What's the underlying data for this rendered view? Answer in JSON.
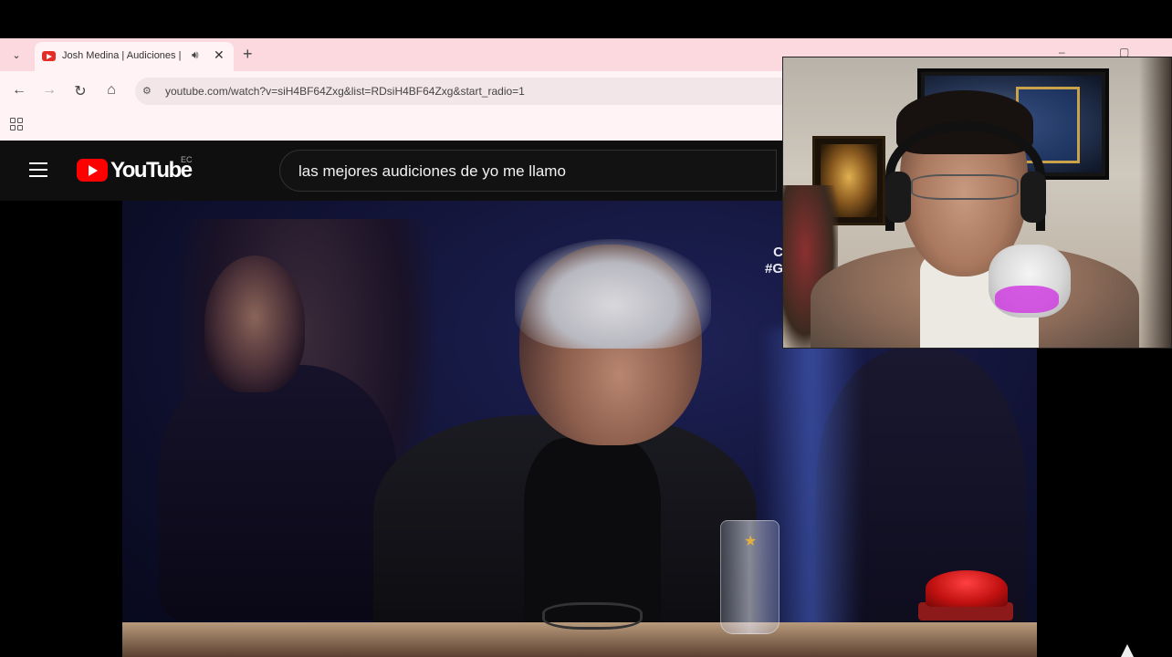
{
  "browser": {
    "tab": {
      "title": "Josh Medina | Audiciones |",
      "audio_icon": "speaker-icon",
      "close_label": "✕"
    },
    "new_tab_label": "+",
    "window_controls": "– ▢ ✕",
    "tab_menu_label": "⌄",
    "nav": {
      "back": "←",
      "forward": "→",
      "reload": "↻",
      "home": "⌂"
    },
    "address": {
      "url": "youtube.com/watch?v=siH4BF64Zxg&list=RDsiH4BF64Zxg&start_radio=1",
      "site_icon": "tune-icon"
    }
  },
  "youtube": {
    "wordmark": "YouTube",
    "country_code": "EC",
    "search_query": "las mejores audiciones de yo me llamo"
  },
  "video": {
    "side_text": "C\n#G",
    "accent_colors": {
      "stage_blue": "#1e2256",
      "buzzer_red": "#e02020"
    }
  },
  "colors": {
    "tabbar_bg": "#fbd9de",
    "chrome_bg": "#fff3f5",
    "youtube_red": "#ff0000",
    "youtube_bg": "#0f0f0f"
  }
}
